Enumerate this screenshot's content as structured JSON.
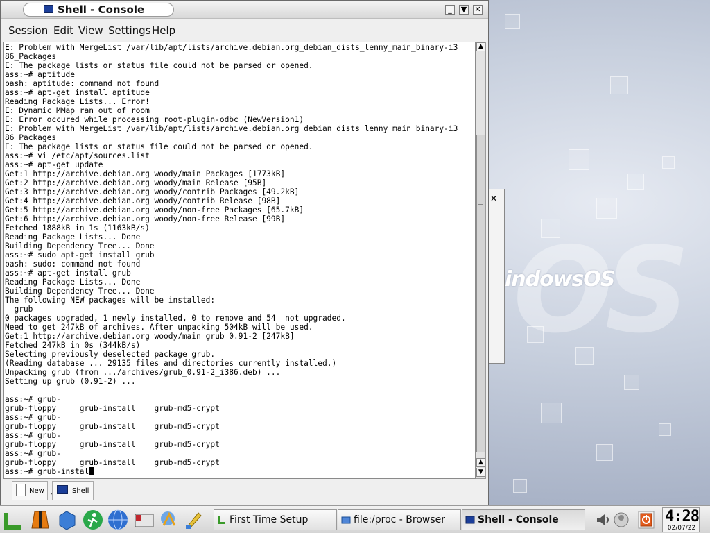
{
  "window": {
    "title": "Shell - Console",
    "menu": [
      "Session",
      "Edit",
      "View",
      "Settings",
      "Help"
    ],
    "buttons": {
      "minimize": "_",
      "maximize": "▼",
      "close": "✕"
    }
  },
  "terminal": {
    "lines": [
      "E: Problem with MergeList /var/lib/apt/lists/archive.debian.org_debian_dists_lenny_main_binary-i3",
      "86_Packages",
      "E: The package lists or status file could not be parsed or opened.",
      "ass:~# aptitude",
      "bash: aptitude: command not found",
      "ass:~# apt-get install aptitude",
      "Reading Package Lists... Error!",
      "E: Dynamic MMap ran out of room",
      "E: Error occured while processing root-plugin-odbc (NewVersion1)",
      "E: Problem with MergeList /var/lib/apt/lists/archive.debian.org_debian_dists_lenny_main_binary-i3",
      "86_Packages",
      "E: The package lists or status file could not be parsed or opened.",
      "ass:~# vi /etc/apt/sources.list",
      "ass:~# apt-get update",
      "Get:1 http://archive.debian.org woody/main Packages [1773kB]",
      "Get:2 http://archive.debian.org woody/main Release [95B]",
      "Get:3 http://archive.debian.org woody/contrib Packages [49.2kB]",
      "Get:4 http://archive.debian.org woody/contrib Release [98B]",
      "Get:5 http://archive.debian.org woody/non-free Packages [65.7kB]",
      "Get:6 http://archive.debian.org woody/non-free Release [99B]",
      "Fetched 1888kB in 1s (1163kB/s)",
      "Reading Package Lists... Done",
      "Building Dependency Tree... Done",
      "ass:~# sudo apt-get install grub",
      "bash: sudo: command not found",
      "ass:~# apt-get install grub",
      "Reading Package Lists... Done",
      "Building Dependency Tree... Done",
      "The following NEW packages will be installed:",
      "  grub",
      "0 packages upgraded, 1 newly installed, 0 to remove and 54  not upgraded.",
      "Need to get 247kB of archives. After unpacking 504kB will be used.",
      "Get:1 http://archive.debian.org woody/main grub 0.91-2 [247kB]",
      "Fetched 247kB in 0s (344kB/s)",
      "Selecting previously deselected package grub.",
      "(Reading database ... 29135 files and directories currently installed.)",
      "Unpacking grub (from .../archives/grub_0.91-2_i386.deb) ...",
      "Setting up grub (0.91-2) ...",
      "",
      "ass:~# grub-",
      "grub-floppy     grub-install    grub-md5-crypt",
      "ass:~# grub-",
      "grub-floppy     grub-install    grub-md5-crypt",
      "ass:~# grub-",
      "grub-floppy     grub-install    grub-md5-crypt",
      "ass:~# grub-",
      "grub-floppy     grub-install    grub-md5-crypt"
    ],
    "prompt_line": "ass:~# grub-instal"
  },
  "session_tabs": {
    "new_label": "New",
    "shell_label": "Shell"
  },
  "wallpaper": {
    "logo_text": "indowsOS",
    "watermark": "OS"
  },
  "taskbar": {
    "tasks": [
      {
        "label": "First Time Setup"
      },
      {
        "label": "file:/proc - Browser"
      },
      {
        "label": "Shell - Console"
      }
    ],
    "clock_time": "4:28",
    "clock_date": "02/07/22"
  },
  "colors": {
    "terminal_bg": "#ffffff",
    "terminal_fg": "#000000",
    "desktop": "#b9c2d2"
  }
}
